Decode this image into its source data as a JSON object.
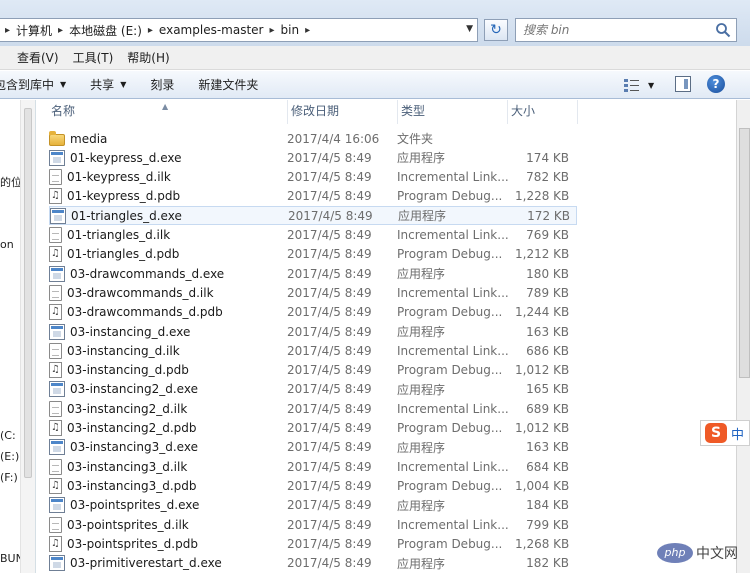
{
  "address": {
    "crumbs": [
      "计算机",
      "本地磁盘 (E:)",
      "examples-master",
      "bin"
    ],
    "refresh_icon": "↻",
    "search_placeholder": "搜索 bin"
  },
  "menu": [
    "查看(V)",
    "工具(T)",
    "帮助(H)"
  ],
  "toolbar": {
    "include_library": "包含到库中",
    "share": "共享",
    "burn": "刻录",
    "new_folder": "新建文件夹",
    "help": "?"
  },
  "nav_fragments": [
    "的位",
    "on",
    "(C:",
    "(E:)",
    "(F:)",
    "BUN"
  ],
  "columns": {
    "name": "名称",
    "date": "修改日期",
    "type": "类型",
    "size": "大小"
  },
  "files": [
    {
      "name": "media",
      "date": "2017/4/4 16:06",
      "type": "文件夹",
      "size": "",
      "icon": "folder"
    },
    {
      "name": "01-keypress_d.exe",
      "date": "2017/4/5 8:49",
      "type": "应用程序",
      "size": "174 KB",
      "icon": "exe"
    },
    {
      "name": "01-keypress_d.ilk",
      "date": "2017/4/5 8:49",
      "type": "Incremental Link...",
      "size": "782 KB",
      "icon": "ilk"
    },
    {
      "name": "01-keypress_d.pdb",
      "date": "2017/4/5 8:49",
      "type": "Program Debug...",
      "size": "1,228 KB",
      "icon": "pdb"
    },
    {
      "name": "01-triangles_d.exe",
      "date": "2017/4/5 8:49",
      "type": "应用程序",
      "size": "172 KB",
      "icon": "exe"
    },
    {
      "name": "01-triangles_d.ilk",
      "date": "2017/4/5 8:49",
      "type": "Incremental Link...",
      "size": "769 KB",
      "icon": "ilk"
    },
    {
      "name": "01-triangles_d.pdb",
      "date": "2017/4/5 8:49",
      "type": "Program Debug...",
      "size": "1,212 KB",
      "icon": "pdb"
    },
    {
      "name": "03-drawcommands_d.exe",
      "date": "2017/4/5 8:49",
      "type": "应用程序",
      "size": "180 KB",
      "icon": "exe"
    },
    {
      "name": "03-drawcommands_d.ilk",
      "date": "2017/4/5 8:49",
      "type": "Incremental Link...",
      "size": "789 KB",
      "icon": "ilk"
    },
    {
      "name": "03-drawcommands_d.pdb",
      "date": "2017/4/5 8:49",
      "type": "Program Debug...",
      "size": "1,244 KB",
      "icon": "pdb"
    },
    {
      "name": "03-instancing_d.exe",
      "date": "2017/4/5 8:49",
      "type": "应用程序",
      "size": "163 KB",
      "icon": "exe"
    },
    {
      "name": "03-instancing_d.ilk",
      "date": "2017/4/5 8:49",
      "type": "Incremental Link...",
      "size": "686 KB",
      "icon": "ilk"
    },
    {
      "name": "03-instancing_d.pdb",
      "date": "2017/4/5 8:49",
      "type": "Program Debug...",
      "size": "1,012 KB",
      "icon": "pdb"
    },
    {
      "name": "03-instancing2_d.exe",
      "date": "2017/4/5 8:49",
      "type": "应用程序",
      "size": "165 KB",
      "icon": "exe"
    },
    {
      "name": "03-instancing2_d.ilk",
      "date": "2017/4/5 8:49",
      "type": "Incremental Link...",
      "size": "689 KB",
      "icon": "ilk"
    },
    {
      "name": "03-instancing2_d.pdb",
      "date": "2017/4/5 8:49",
      "type": "Program Debug...",
      "size": "1,012 KB",
      "icon": "pdb"
    },
    {
      "name": "03-instancing3_d.exe",
      "date": "2017/4/5 8:49",
      "type": "应用程序",
      "size": "163 KB",
      "icon": "exe"
    },
    {
      "name": "03-instancing3_d.ilk",
      "date": "2017/4/5 8:49",
      "type": "Incremental Link...",
      "size": "684 KB",
      "icon": "ilk"
    },
    {
      "name": "03-instancing3_d.pdb",
      "date": "2017/4/5 8:49",
      "type": "Program Debug...",
      "size": "1,004 KB",
      "icon": "pdb"
    },
    {
      "name": "03-pointsprites_d.exe",
      "date": "2017/4/5 8:49",
      "type": "应用程序",
      "size": "184 KB",
      "icon": "exe"
    },
    {
      "name": "03-pointsprites_d.ilk",
      "date": "2017/4/5 8:49",
      "type": "Incremental Link...",
      "size": "799 KB",
      "icon": "ilk"
    },
    {
      "name": "03-pointsprites_d.pdb",
      "date": "2017/4/5 8:49",
      "type": "Program Debug...",
      "size": "1,268 KB",
      "icon": "pdb"
    },
    {
      "name": "03-primitiverestart_d.exe",
      "date": "2017/4/5 8:49",
      "type": "应用程序",
      "size": "182 KB",
      "icon": "exe"
    }
  ],
  "selected_index": 4,
  "overlays": {
    "ime_logo": "S",
    "ime_text": "中",
    "php_logo": "php",
    "php_text": "中文网"
  }
}
